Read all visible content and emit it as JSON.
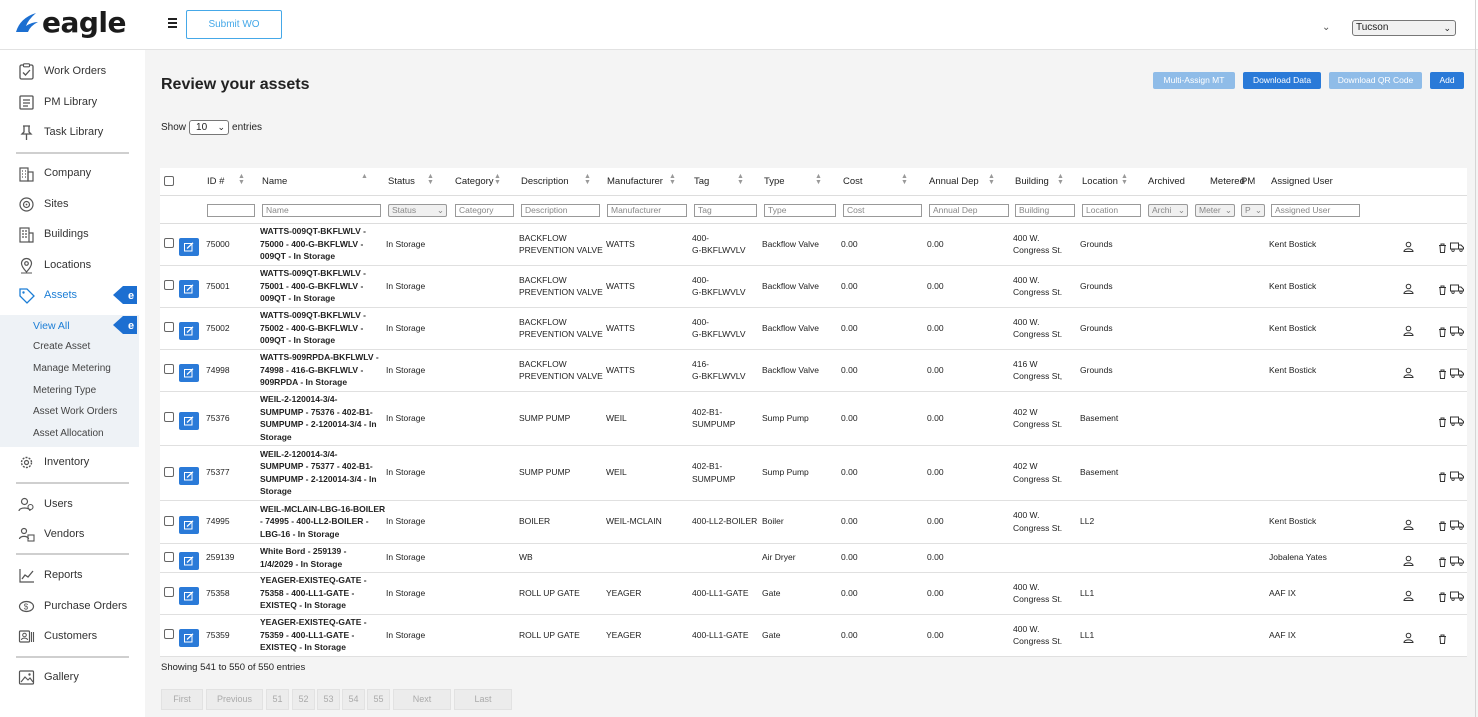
{
  "brand": {
    "name": "eagle"
  },
  "header": {
    "submit_wo": "Submit WO",
    "location_select": "Tucson"
  },
  "sidebar": {
    "items": [
      {
        "label": "Work Orders",
        "icon": "clipboard-check-icon"
      },
      {
        "label": "PM Library",
        "icon": "list-icon"
      },
      {
        "label": "Task Library",
        "icon": "pin-icon"
      },
      {
        "label": "Company",
        "icon": "building-icon"
      },
      {
        "label": "Sites",
        "icon": "target-icon"
      },
      {
        "label": "Buildings",
        "icon": "buildings-icon"
      },
      {
        "label": "Locations",
        "icon": "map-pin-icon"
      },
      {
        "label": "Assets",
        "icon": "tag-icon"
      },
      {
        "label": "Inventory",
        "icon": "gear-icon"
      },
      {
        "label": "Users",
        "icon": "users-icon"
      },
      {
        "label": "Vendors",
        "icon": "vendor-icon"
      },
      {
        "label": "Reports",
        "icon": "chart-line-icon"
      },
      {
        "label": "Purchase Orders",
        "icon": "dollar-icon"
      },
      {
        "label": "Customers",
        "icon": "id-card-icon"
      },
      {
        "label": "Gallery",
        "icon": "image-icon"
      }
    ],
    "sub_items": [
      "View All",
      "Create Asset",
      "Manage Metering",
      "Metering Type",
      "Asset Work Orders",
      "Asset Allocation"
    ]
  },
  "page": {
    "title": "Review your assets",
    "show_prefix": "Show",
    "show_value": "10",
    "show_suffix": "entries",
    "buttons": {
      "multi_assign": "Multi-Assign MT",
      "download_data": "Download Data",
      "download_qr": "Download QR Code",
      "add": "Add"
    },
    "showing_text": "Showing 541 to 550 of 550 entries"
  },
  "table": {
    "headers": {
      "id": "ID #",
      "name": "Name",
      "status": "Status",
      "category": "Category",
      "description": "Description",
      "manufacturer": "Manufacturer",
      "tag": "Tag",
      "type": "Type",
      "cost": "Cost",
      "annual_dep": "Annual Dep",
      "building": "Building",
      "location": "Location",
      "archived": "Archived",
      "metered": "Metered",
      "pm": "PM",
      "assigned_user": "Assigned User"
    },
    "filters": {
      "id": "",
      "name": "Name",
      "status": "Status",
      "category": "Category",
      "description": "Description",
      "manufacturer": "Manufacturer",
      "tag": "Tag",
      "type": "Type",
      "cost": "Cost",
      "annual_dep": "Annual Dep",
      "building": "Building",
      "location": "Location",
      "archived": "Archi",
      "metered": "Meter",
      "pm": "P",
      "assigned_user": "Assigned User"
    },
    "rows": [
      {
        "id": "75000",
        "name": [
          "WATTS-009QT-BKFLWLV -",
          "75000 - 400-G-BKFLWLV -",
          "009QT - In Storage"
        ],
        "status": "In Storage",
        "description": [
          "BACKFLOW",
          "PREVENTION VALVE"
        ],
        "manufacturer": "WATTS",
        "tag": [
          "400-",
          "G-BKFLWVLV"
        ],
        "type": "Backflow Valve",
        "cost": "0.00",
        "annual_dep": "0.00",
        "building": [
          "400 W.",
          "Congress St."
        ],
        "location": "Grounds",
        "assigned_user": "Kent Bostick"
      },
      {
        "id": "75001",
        "name": [
          "WATTS-009QT-BKFLWLV -",
          "75001 - 400-G-BKFLWLV -",
          "009QT - In Storage"
        ],
        "status": "In Storage",
        "description": [
          "BACKFLOW",
          "PREVENTION VALVE"
        ],
        "manufacturer": "WATTS",
        "tag": [
          "400-",
          "G-BKFLWVLV"
        ],
        "type": "Backflow Valve",
        "cost": "0.00",
        "annual_dep": "0.00",
        "building": [
          "400 W.",
          "Congress St."
        ],
        "location": "Grounds",
        "assigned_user": "Kent Bostick"
      },
      {
        "id": "75002",
        "name": [
          "WATTS-009QT-BKFLWLV -",
          "75002 - 400-G-BKFLWLV -",
          "009QT - In Storage"
        ],
        "status": "In Storage",
        "description": [
          "BACKFLOW",
          "PREVENTION VALVE"
        ],
        "manufacturer": "WATTS",
        "tag": [
          "400-",
          "G-BKFLWVLV"
        ],
        "type": "Backflow Valve",
        "cost": "0.00",
        "annual_dep": "0.00",
        "building": [
          "400 W.",
          "Congress St."
        ],
        "location": "Grounds",
        "assigned_user": "Kent Bostick"
      },
      {
        "id": "74998",
        "name": [
          "WATTS-909RPDA-BKFLWLV -",
          "74998 - 416-G-BKFLWLV -",
          "909RPDA - In Storage"
        ],
        "status": "In Storage",
        "description": [
          "BACKFLOW",
          "PREVENTION VALVE"
        ],
        "manufacturer": "WATTS",
        "tag": [
          "416-",
          "G-BKFLWVLV"
        ],
        "type": "Backflow Valve",
        "cost": "0.00",
        "annual_dep": "0.00",
        "building": [
          "416 W",
          "Congress St,"
        ],
        "location": "Grounds",
        "assigned_user": "Kent Bostick"
      },
      {
        "id": "75376",
        "name": [
          "WEIL-2-120014-3/4-",
          "SUMPUMP - 75376 - 402-B1-",
          "SUMPUMP - 2-120014-3/4 - In",
          "Storage"
        ],
        "status": "In Storage",
        "description": [
          "SUMP PUMP"
        ],
        "manufacturer": "WEIL",
        "tag": [
          "402-B1-",
          "SUMPUMP"
        ],
        "type": "Sump Pump",
        "cost": "0.00",
        "annual_dep": "0.00",
        "building": [
          "402 W",
          "Congress St."
        ],
        "location": "Basement",
        "assigned_user": ""
      },
      {
        "id": "75377",
        "name": [
          "WEIL-2-120014-3/4-",
          "SUMPUMP - 75377 - 402-B1-",
          "SUMPUMP - 2-120014-3/4 - In",
          "Storage"
        ],
        "status": "In Storage",
        "description": [
          "SUMP PUMP"
        ],
        "manufacturer": "WEIL",
        "tag": [
          "402-B1-",
          "SUMPUMP"
        ],
        "type": "Sump Pump",
        "cost": "0.00",
        "annual_dep": "0.00",
        "building": [
          "402 W",
          "Congress St."
        ],
        "location": "Basement",
        "assigned_user": ""
      },
      {
        "id": "74995",
        "name": [
          "WEIL-MCLAIN-LBG-16-BOILER",
          "- 74995 - 400-LL2-BOILER -",
          "LBG-16 - In Storage"
        ],
        "status": "In Storage",
        "description": [
          "BOILER"
        ],
        "manufacturer": "WEIL-MCLAIN",
        "tag": [
          "400-LL2-BOILER"
        ],
        "type": "Boiler",
        "cost": "0.00",
        "annual_dep": "0.00",
        "building": [
          "400 W.",
          "Congress St."
        ],
        "location": "LL2",
        "assigned_user": "Kent Bostick"
      },
      {
        "id": "259139",
        "name": [
          "White Bord - 259139 -",
          "1/4/2029 - In Storage"
        ],
        "status": "In Storage",
        "description": [
          "WB"
        ],
        "manufacturer": "",
        "tag": [],
        "type": "Air Dryer",
        "cost": "0.00",
        "annual_dep": "0.00",
        "building": [],
        "location": "",
        "assigned_user": "Jobalena Yates"
      },
      {
        "id": "75358",
        "name": [
          "YEAGER-EXISTEQ-GATE -",
          "75358 - 400-LL1-GATE -",
          "EXISTEQ - In Storage"
        ],
        "status": "In Storage",
        "description": [
          "ROLL UP GATE"
        ],
        "manufacturer": "YEAGER",
        "tag": [
          "400-LL1-GATE"
        ],
        "type": "Gate",
        "cost": "0.00",
        "annual_dep": "0.00",
        "building": [
          "400 W.",
          "Congress St."
        ],
        "location": "LL1",
        "assigned_user": "AAF IX"
      },
      {
        "id": "75359",
        "name": [
          "YEAGER-EXISTEQ-GATE -",
          "75359 - 400-LL1-GATE -",
          "EXISTEQ - In Storage"
        ],
        "status": "In Storage",
        "description": [
          "ROLL UP GATE"
        ],
        "manufacturer": "YEAGER",
        "tag": [
          "400-LL1-GATE"
        ],
        "type": "Gate",
        "cost": "0.00",
        "annual_dep": "0.00",
        "building": [
          "400 W.",
          "Congress St."
        ],
        "location": "LL1",
        "assigned_user": "AAF IX"
      }
    ]
  },
  "pagination": [
    "First",
    "Previous",
    "51",
    "52",
    "53",
    "54",
    "55",
    "Next",
    "Last"
  ],
  "colors": {
    "primary": "#2a7ad8",
    "primary_light": "#8fbce8",
    "accent": "#1c7ed6"
  }
}
